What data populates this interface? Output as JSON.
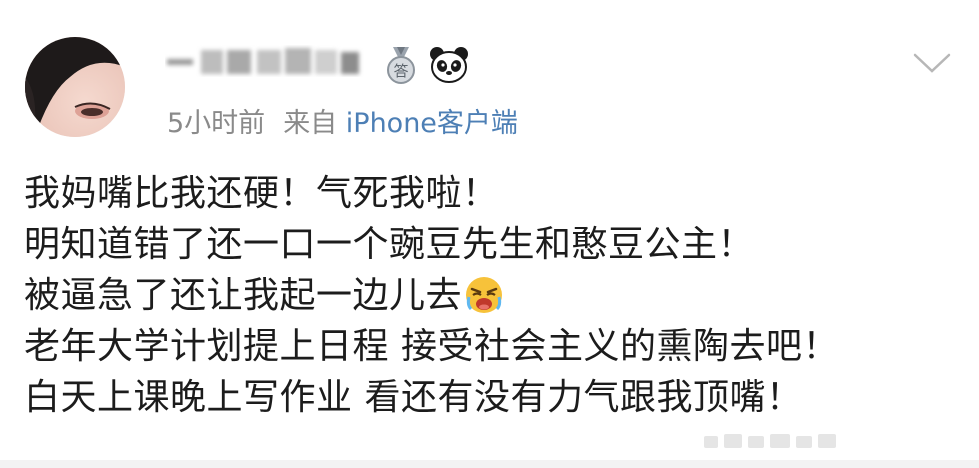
{
  "post": {
    "author": {
      "name_blurred": "一一"
    },
    "meta": {
      "time": "5小时前",
      "source_prefix": "来自",
      "source_link": "iPhone客户端"
    },
    "lines": [
      "我妈嘴比我还硬！气死我啦！",
      "明知道错了还一口一个豌豆先生和憨豆公主！",
      "被逼急了还让我起一边儿去",
      "老年大学计划提上日程 接受社会主义的熏陶去吧！",
      "白天上课晚上写作业 看还有没有力气跟我顶嘴！"
    ]
  },
  "icons": {
    "badge": "medal-icon",
    "panda": "panda-icon",
    "chevron": "chevron-down-icon",
    "emoji": "crying-face-emoji"
  },
  "colors": {
    "meta_gray": "#8a8a8a",
    "link_blue": "#4d7fb5",
    "text": "#1c1c1c"
  }
}
